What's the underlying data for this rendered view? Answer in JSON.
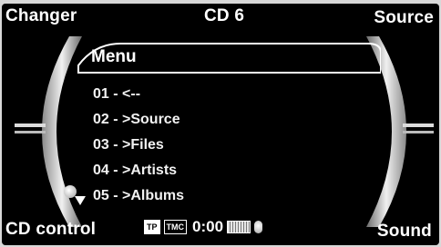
{
  "header": {
    "left_label": "Changer",
    "center_label": "CD 6",
    "right_label": "Source"
  },
  "menu": {
    "title": "Menu",
    "items": [
      "01 - <--",
      "02 - >Source",
      "03 - >Files",
      "04 - >Artists",
      "05 - >Albums"
    ]
  },
  "footer": {
    "left_label": "CD control",
    "right_label": "Sound",
    "tp_label": "TP",
    "tmc_label": "TMC",
    "time": "0:00"
  },
  "icons": {
    "battery": "battery-icon",
    "microphone": "microphone-icon",
    "scroll_down": "scroll-down-arrow-icon"
  },
  "colors": {
    "background": "#000000",
    "text": "#ffffff"
  }
}
